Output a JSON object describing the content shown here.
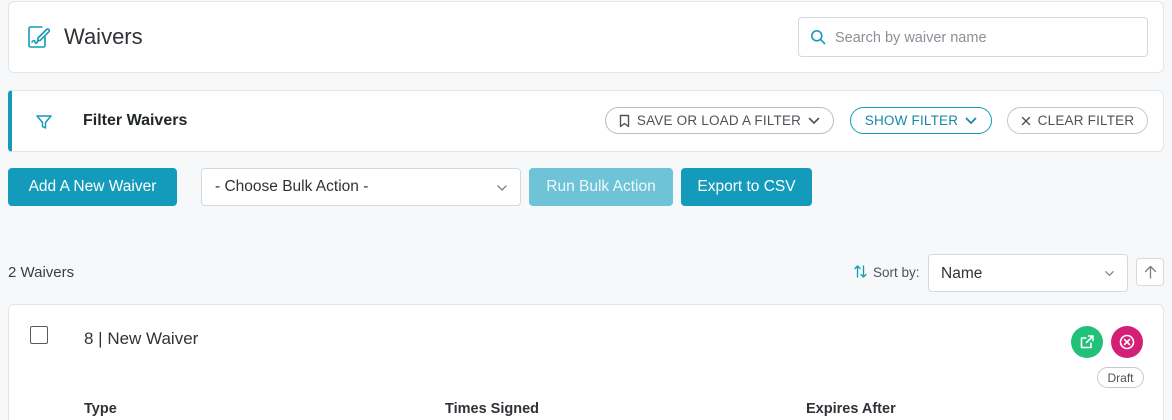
{
  "header": {
    "title": "Waivers",
    "search_placeholder": "Search by waiver name"
  },
  "filter": {
    "title": "Filter Waivers",
    "save_load_label": "SAVE OR LOAD A FILTER",
    "show_filter_label": "SHOW FILTER",
    "clear_filter_label": "CLEAR FILTER"
  },
  "actions": {
    "add_label": "Add A New Waiver",
    "bulk_action_value": "- Choose Bulk Action -",
    "run_label": "Run Bulk Action",
    "export_label": "Export to CSV"
  },
  "list": {
    "count_text": "2 Waivers",
    "sort_label": "Sort by:",
    "sort_value": "Name"
  },
  "waivers": [
    {
      "title": "8 | New Waiver",
      "status": "Draft",
      "columns": [
        "Type",
        "Times Signed",
        "Expires After"
      ]
    }
  ],
  "colors": {
    "accent": "#149bbb",
    "success": "#21c17a",
    "danger": "#d41f78",
    "disabled": "#6ec3d6"
  }
}
